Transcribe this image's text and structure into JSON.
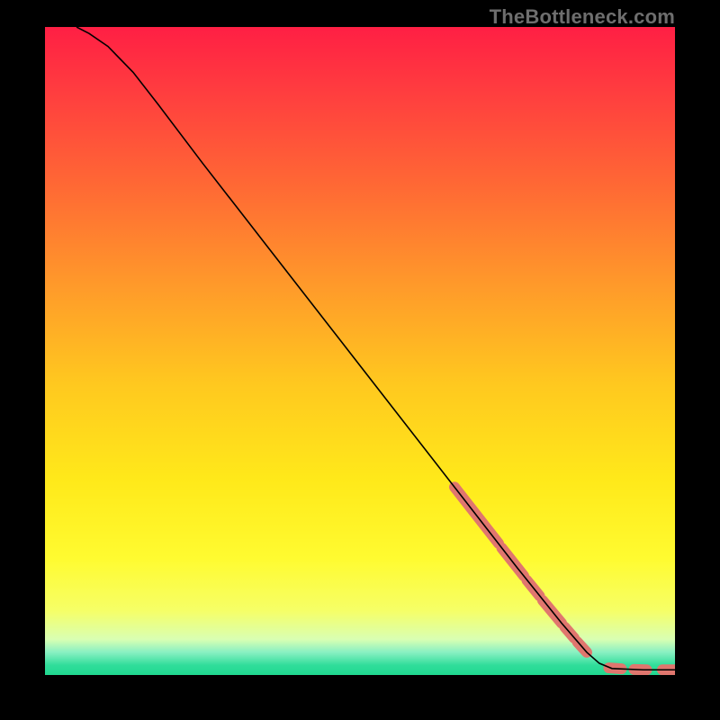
{
  "watermark": "TheBottleneck.com",
  "chart_data": {
    "type": "line",
    "title": "",
    "xlabel": "",
    "ylabel": "",
    "xlim": [
      0,
      100
    ],
    "ylim": [
      0,
      100
    ],
    "grid": false,
    "curve": {
      "name": "curve",
      "color": "#000000",
      "points": [
        {
          "x": 5,
          "y": 100
        },
        {
          "x": 7,
          "y": 99
        },
        {
          "x": 10,
          "y": 97
        },
        {
          "x": 14,
          "y": 93
        },
        {
          "x": 18,
          "y": 88
        },
        {
          "x": 25,
          "y": 79
        },
        {
          "x": 35,
          "y": 66.5
        },
        {
          "x": 45,
          "y": 54
        },
        {
          "x": 55,
          "y": 41.5
        },
        {
          "x": 65,
          "y": 29
        },
        {
          "x": 75,
          "y": 16.5
        },
        {
          "x": 82,
          "y": 8
        },
        {
          "x": 86,
          "y": 3.5
        },
        {
          "x": 88,
          "y": 1.8
        },
        {
          "x": 90,
          "y": 1.0
        },
        {
          "x": 95,
          "y": 0.8
        },
        {
          "x": 100,
          "y": 0.8
        }
      ]
    },
    "highlight_segments": {
      "name": "highlights",
      "color": "#e0766e",
      "width": 12,
      "segments": [
        {
          "from": {
            "x": 65,
            "y": 29.0
          },
          "to": {
            "x": 72,
            "y": 20.3
          }
        },
        {
          "from": {
            "x": 72.5,
            "y": 19.6
          },
          "to": {
            "x": 76,
            "y": 15.3
          }
        },
        {
          "from": {
            "x": 76.5,
            "y": 14.6
          },
          "to": {
            "x": 78.5,
            "y": 12.2
          }
        },
        {
          "from": {
            "x": 79.0,
            "y": 11.5
          },
          "to": {
            "x": 82.0,
            "y": 8.0
          }
        },
        {
          "from": {
            "x": 82.5,
            "y": 7.4
          },
          "to": {
            "x": 84.0,
            "y": 5.7
          }
        },
        {
          "from": {
            "x": 84.5,
            "y": 5.1
          },
          "to": {
            "x": 86.0,
            "y": 3.5
          }
        },
        {
          "from": {
            "x": 89.5,
            "y": 1.1
          },
          "to": {
            "x": 91.5,
            "y": 0.95
          }
        },
        {
          "from": {
            "x": 93.5,
            "y": 0.85
          },
          "to": {
            "x": 95.5,
            "y": 0.8
          }
        },
        {
          "from": {
            "x": 98.0,
            "y": 0.8
          },
          "to": {
            "x": 100.0,
            "y": 0.8
          }
        }
      ]
    },
    "background_gradient": {
      "stops": [
        {
          "offset": 0.0,
          "color": "#ff1f44"
        },
        {
          "offset": 0.1,
          "color": "#ff3d3f"
        },
        {
          "offset": 0.25,
          "color": "#ff6a34"
        },
        {
          "offset": 0.4,
          "color": "#ff9a2a"
        },
        {
          "offset": 0.55,
          "color": "#ffc81f"
        },
        {
          "offset": 0.7,
          "color": "#ffe91a"
        },
        {
          "offset": 0.82,
          "color": "#fffb30"
        },
        {
          "offset": 0.9,
          "color": "#f6ff66"
        },
        {
          "offset": 0.945,
          "color": "#d9ffb3"
        },
        {
          "offset": 0.965,
          "color": "#88f0c2"
        },
        {
          "offset": 0.985,
          "color": "#30dd9a"
        },
        {
          "offset": 1.0,
          "color": "#20d890"
        }
      ]
    }
  }
}
